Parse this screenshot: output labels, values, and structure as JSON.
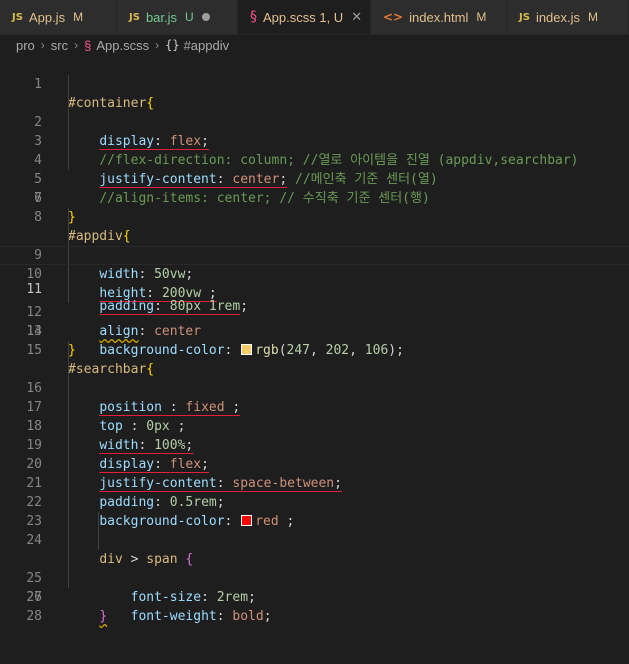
{
  "tabs": [
    {
      "icon": "JS",
      "label": "App.js",
      "status": "M"
    },
    {
      "icon": "JS",
      "label": "bar.js",
      "status": "U"
    },
    {
      "icon": "§",
      "label": "App.scss 1, U",
      "status": ""
    },
    {
      "icon": "<>",
      "label": "index.html",
      "status": "M"
    },
    {
      "icon": "JS",
      "label": "index.js",
      "status": "M"
    }
  ],
  "breadcrumb": {
    "parts": [
      "pro",
      "src",
      "App.scss",
      "#appdiv"
    ]
  },
  "colors": {
    "swatch_appdiv": "#f7ca6a",
    "swatch_red": "#ff0000"
  },
  "code": {
    "lines": [
      "1",
      "2",
      "3",
      "4",
      "5",
      "6",
      "7",
      "8",
      "9",
      "10",
      "11",
      "12",
      "13",
      "14",
      "15",
      "16",
      "17",
      "18",
      "19",
      "20",
      "21",
      "22",
      "23",
      "24",
      "25",
      "26",
      "27",
      "28"
    ],
    "l1": {
      "sel": "#container",
      "brace": "{"
    },
    "l2": {
      "prop": "display",
      "val": "flex"
    },
    "l3": {
      "comment": "//flex-direction: column; //열로 아이템을 진열 (appdiv,searchbar)"
    },
    "l4": {
      "prop": "justify-content",
      "val": "center",
      "comment": "//메인축 기준 센터(열)"
    },
    "l5": {
      "comment": "//align-items: center; // 수직축 기준 센터(행)"
    },
    "l7": {
      "brace": "}"
    },
    "l8": {
      "sel": "#appdiv",
      "brace": "{"
    },
    "l9": {
      "prop": "width",
      "num": "50vw"
    },
    "l10": {
      "prop": "height",
      "num": "200vw",
      "tail": " ;"
    },
    "l11": {
      "prop": "padding",
      "num1": "80px",
      "num2": "1rem"
    },
    "l12": {
      "prop": "align",
      "val": "center"
    },
    "l13": {
      "prop": "background-color",
      "fn": "rgb",
      "args_open": "(",
      "a1": "247",
      "a2": "202",
      "a3": "106",
      "args_close": ")"
    },
    "l14": {
      "brace": "}"
    },
    "l15": {
      "sel": "#searchbar",
      "brace": "{"
    },
    "l16": {
      "prop": "position",
      "sep": " : ",
      "val": "fixed",
      "tail": " ;"
    },
    "l17": {
      "prop": "top",
      "sep": " : ",
      "num": "0px",
      "tail": " ;"
    },
    "l18": {
      "prop": "width",
      "num": "100%"
    },
    "l19": {
      "prop": "display",
      "val": "flex"
    },
    "l20": {
      "prop": "justify-content",
      "val": "space-between"
    },
    "l21": {
      "prop": "padding",
      "num": "0.5rem"
    },
    "l22": {
      "prop": "background-color",
      "val": "red",
      "tail": " ;"
    },
    "l24": {
      "sel1": "div",
      "op": ">",
      "sel2": "span",
      "brace": "{"
    },
    "l25": {
      "prop": "font-size",
      "num": "2rem"
    },
    "l26": {
      "prop": "font-weight",
      "val": "bold"
    },
    "l27": {
      "brace": "}"
    }
  }
}
